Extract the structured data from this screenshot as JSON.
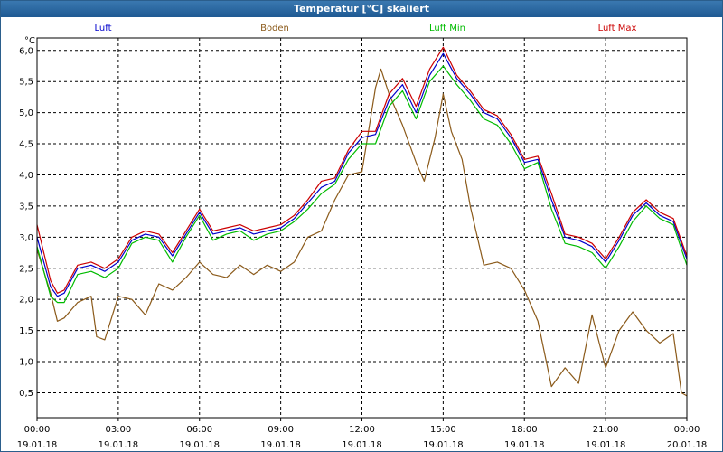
{
  "chart_data": {
    "type": "line",
    "title": "Temperatur [°C] skaliert",
    "ylabel": "°C",
    "ylim": [
      0.1,
      6.2
    ],
    "yticks": [
      0.5,
      1.0,
      1.5,
      2.0,
      2.5,
      3.0,
      3.5,
      4.0,
      4.5,
      5.0,
      5.5,
      6.0
    ],
    "ytick_labels": [
      "0,5",
      "1,0",
      "1,5",
      "2,0",
      "2,5",
      "3,0",
      "3,5",
      "4,0",
      "4,5",
      "5,0",
      "5,5",
      "6,0"
    ],
    "xlim": [
      0,
      24
    ],
    "xticks": [
      0,
      3,
      6,
      9,
      12,
      15,
      18,
      21,
      24
    ],
    "xtick_times": [
      "00:00",
      "03:00",
      "06:00",
      "09:00",
      "12:00",
      "15:00",
      "18:00",
      "21:00",
      "00:00"
    ],
    "xtick_dates": [
      "19.01.18",
      "19.01.18",
      "19.01.18",
      "19.01.18",
      "19.01.18",
      "19.01.18",
      "19.01.18",
      "19.01.18",
      "20.01.18"
    ],
    "grid": true,
    "legend_position": "top",
    "series": [
      {
        "name": "Luft",
        "color": "#0000cc",
        "x": [
          0,
          0.5,
          0.75,
          1.0,
          1.5,
          2.0,
          2.5,
          3.0,
          3.5,
          4.0,
          4.5,
          5.0,
          5.5,
          6.0,
          6.5,
          7.0,
          7.5,
          8.0,
          8.5,
          9.0,
          9.5,
          10.0,
          10.5,
          11.0,
          11.5,
          12.0,
          12.5,
          13.0,
          13.5,
          14.0,
          14.5,
          15.0,
          15.5,
          16.0,
          16.5,
          17.0,
          17.5,
          18.0,
          18.5,
          19.0,
          19.5,
          20.0,
          20.5,
          21.0,
          21.5,
          22.0,
          22.5,
          23.0,
          23.5,
          24.0
        ],
        "y": [
          3.0,
          2.2,
          2.05,
          2.1,
          2.5,
          2.55,
          2.45,
          2.6,
          2.95,
          3.05,
          3.0,
          2.7,
          3.05,
          3.4,
          3.05,
          3.1,
          3.15,
          3.05,
          3.1,
          3.15,
          3.3,
          3.55,
          3.8,
          3.9,
          4.35,
          4.6,
          4.65,
          5.2,
          5.45,
          5.0,
          5.6,
          5.95,
          5.55,
          5.3,
          5.0,
          4.9,
          4.6,
          4.2,
          4.25,
          3.6,
          3.0,
          2.95,
          2.85,
          2.6,
          2.95,
          3.35,
          3.55,
          3.35,
          3.25,
          2.65
        ]
      },
      {
        "name": "Boden",
        "color": "#8b5a1a",
        "x": [
          0,
          0.5,
          0.75,
          1.0,
          1.5,
          2.0,
          2.2,
          2.5,
          3.0,
          3.5,
          4.0,
          4.5,
          5.0,
          5.5,
          6.0,
          6.5,
          7.0,
          7.5,
          8.0,
          8.5,
          9.0,
          9.5,
          10.0,
          10.5,
          11.0,
          11.5,
          12.0,
          12.5,
          12.7,
          13.0,
          13.5,
          14.0,
          14.3,
          14.7,
          15.0,
          15.3,
          15.7,
          16.0,
          16.5,
          17.0,
          17.5,
          18.0,
          18.5,
          19.0,
          19.5,
          20.0,
          20.5,
          21.0,
          21.5,
          22.0,
          22.5,
          23.0,
          23.5,
          23.8,
          24.0
        ],
        "y": [
          2.8,
          2.1,
          1.65,
          1.7,
          1.95,
          2.05,
          1.4,
          1.35,
          2.05,
          2.0,
          1.75,
          2.25,
          2.15,
          2.35,
          2.6,
          2.4,
          2.35,
          2.55,
          2.4,
          2.55,
          2.45,
          2.6,
          3.0,
          3.1,
          3.6,
          4.0,
          4.05,
          5.4,
          5.7,
          5.3,
          4.8,
          4.2,
          3.9,
          4.6,
          5.3,
          4.7,
          4.25,
          3.5,
          2.55,
          2.6,
          2.5,
          2.15,
          1.65,
          0.6,
          0.9,
          0.65,
          1.75,
          0.9,
          1.5,
          1.8,
          1.5,
          1.3,
          1.45,
          0.5,
          0.45
        ]
      },
      {
        "name": "Luft Min",
        "color": "#00bb00",
        "x": [
          0,
          0.5,
          0.75,
          1.0,
          1.5,
          2.0,
          2.5,
          3.0,
          3.5,
          4.0,
          4.5,
          5.0,
          5.5,
          6.0,
          6.5,
          7.0,
          7.5,
          8.0,
          8.5,
          9.0,
          9.5,
          10.0,
          10.5,
          11.0,
          11.5,
          12.0,
          12.5,
          13.0,
          13.5,
          14.0,
          14.5,
          15.0,
          15.5,
          16.0,
          16.5,
          17.0,
          17.5,
          18.0,
          18.5,
          19.0,
          19.5,
          20.0,
          20.5,
          21.0,
          21.5,
          22.0,
          22.5,
          23.0,
          23.5,
          24.0
        ],
        "y": [
          2.85,
          2.05,
          1.95,
          1.95,
          2.4,
          2.45,
          2.35,
          2.5,
          2.9,
          3.0,
          2.95,
          2.6,
          3.0,
          3.35,
          2.95,
          3.05,
          3.1,
          2.95,
          3.05,
          3.1,
          3.25,
          3.45,
          3.7,
          3.85,
          4.25,
          4.5,
          4.5,
          5.1,
          5.35,
          4.9,
          5.5,
          5.75,
          5.45,
          5.2,
          4.9,
          4.8,
          4.5,
          4.1,
          4.2,
          3.45,
          2.9,
          2.85,
          2.75,
          2.5,
          2.85,
          3.25,
          3.5,
          3.3,
          3.2,
          2.55
        ]
      },
      {
        "name": "Luft Max",
        "color": "#cc0000",
        "x": [
          0,
          0.5,
          0.75,
          1.0,
          1.5,
          2.0,
          2.5,
          3.0,
          3.5,
          4.0,
          4.5,
          5.0,
          5.5,
          6.0,
          6.5,
          7.0,
          7.5,
          8.0,
          8.5,
          9.0,
          9.5,
          10.0,
          10.5,
          11.0,
          11.5,
          12.0,
          12.5,
          13.0,
          13.5,
          14.0,
          14.5,
          15.0,
          15.5,
          16.0,
          16.5,
          17.0,
          17.5,
          18.0,
          18.5,
          19.0,
          19.5,
          20.0,
          20.5,
          21.0,
          21.5,
          22.0,
          22.5,
          23.0,
          23.5,
          24.0
        ],
        "y": [
          3.2,
          2.3,
          2.1,
          2.15,
          2.55,
          2.6,
          2.5,
          2.65,
          3.0,
          3.1,
          3.05,
          2.75,
          3.1,
          3.45,
          3.1,
          3.15,
          3.2,
          3.1,
          3.15,
          3.2,
          3.35,
          3.6,
          3.9,
          3.95,
          4.4,
          4.7,
          4.7,
          5.3,
          5.55,
          5.1,
          5.7,
          6.05,
          5.6,
          5.35,
          5.05,
          4.95,
          4.65,
          4.25,
          4.3,
          3.7,
          3.05,
          3.0,
          2.9,
          2.65,
          3.0,
          3.4,
          3.6,
          3.4,
          3.3,
          2.7
        ]
      }
    ]
  }
}
